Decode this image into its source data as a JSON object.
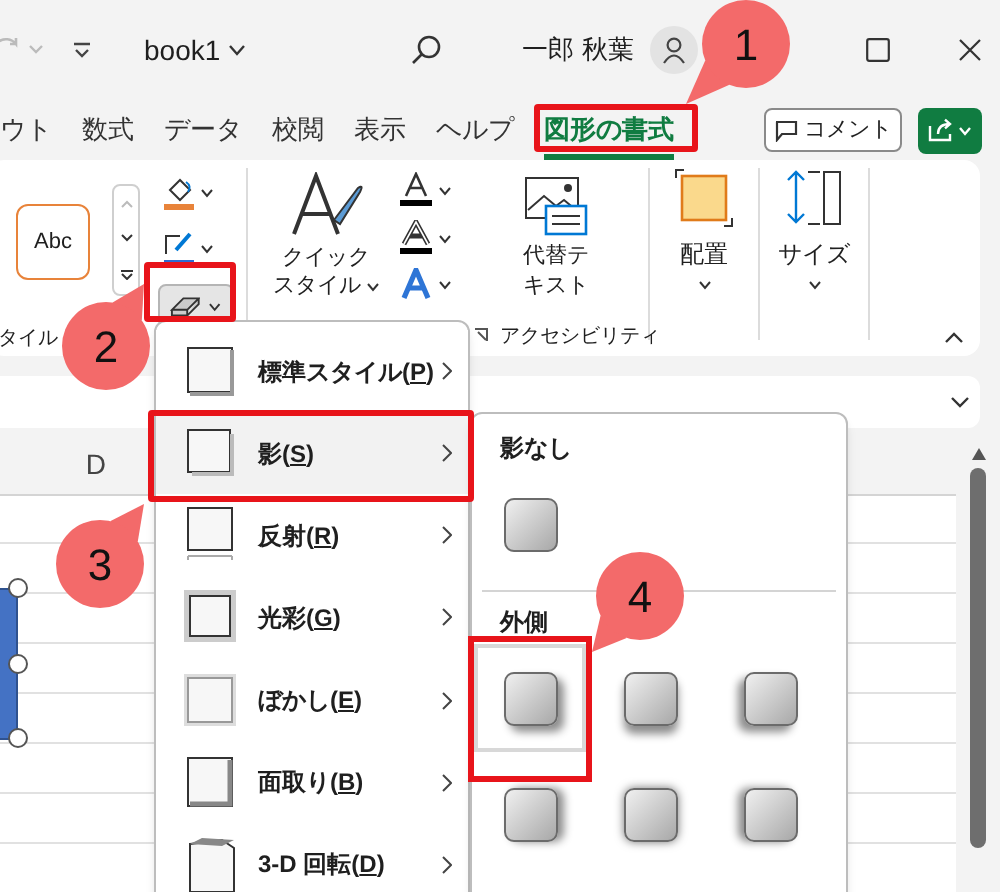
{
  "title_bar": {
    "file_name": "book1",
    "user_name": "一郎 秋葉"
  },
  "tabs": [
    {
      "label": "ウト",
      "selected": false
    },
    {
      "label": "数式",
      "selected": false
    },
    {
      "label": "データ",
      "selected": false
    },
    {
      "label": "校閲",
      "selected": false
    },
    {
      "label": "表示",
      "selected": false
    },
    {
      "label": "ヘルプ",
      "selected": false
    },
    {
      "label": "図形の書式",
      "selected": true
    }
  ],
  "comment_button": "コメント",
  "ribbon": {
    "style_preview": "Abc",
    "style_group_label": "タイル",
    "shape_effects_pressed": true,
    "quick_styles": [
      "クイック",
      "スタイル"
    ],
    "alt_text": [
      "代替テ",
      "キスト"
    ],
    "accessibility_label": "アクセシビリティ",
    "arrange": "配置",
    "size": "サイズ"
  },
  "sheet": {
    "column_header": "D"
  },
  "effects_menu": [
    {
      "kind": "standard",
      "label": "標準スタイル(",
      "access_key": "P",
      "label_end": ")",
      "selected": false
    },
    {
      "kind": "shadow",
      "label": "影(",
      "access_key": "S",
      "label_end": ")",
      "selected": true
    },
    {
      "kind": "reflection",
      "label": "反射(",
      "access_key": "R",
      "label_end": ")",
      "selected": false
    },
    {
      "kind": "glow",
      "label": "光彩(",
      "access_key": "G",
      "label_end": ")",
      "selected": false
    },
    {
      "kind": "soft-edges",
      "label": "ぼかし(",
      "access_key": "E",
      "label_end": ")",
      "selected": false
    },
    {
      "kind": "bevel",
      "label": "面取り(",
      "access_key": "B",
      "label_end": ")",
      "selected": false
    },
    {
      "kind": "rotation",
      "label": "3-D 回転(",
      "access_key": "D",
      "label_end": ")",
      "selected": false
    }
  ],
  "shadow_menu": {
    "sections": [
      {
        "heading": "影なし",
        "presets": [
          {
            "kind": "none",
            "selected": false
          }
        ]
      },
      {
        "heading": "外側",
        "presets": [
          {
            "kind": "bottom-right",
            "selected": true
          },
          {
            "kind": "bottom",
            "selected": false
          },
          {
            "kind": "bottom-left",
            "selected": false
          },
          {
            "kind": "right",
            "selected": false
          },
          {
            "kind": "center",
            "selected": false
          },
          {
            "kind": "left",
            "selected": false
          }
        ]
      }
    ]
  },
  "callouts": [
    {
      "number": "1"
    },
    {
      "number": "2"
    },
    {
      "number": "3"
    },
    {
      "number": "4"
    }
  ]
}
